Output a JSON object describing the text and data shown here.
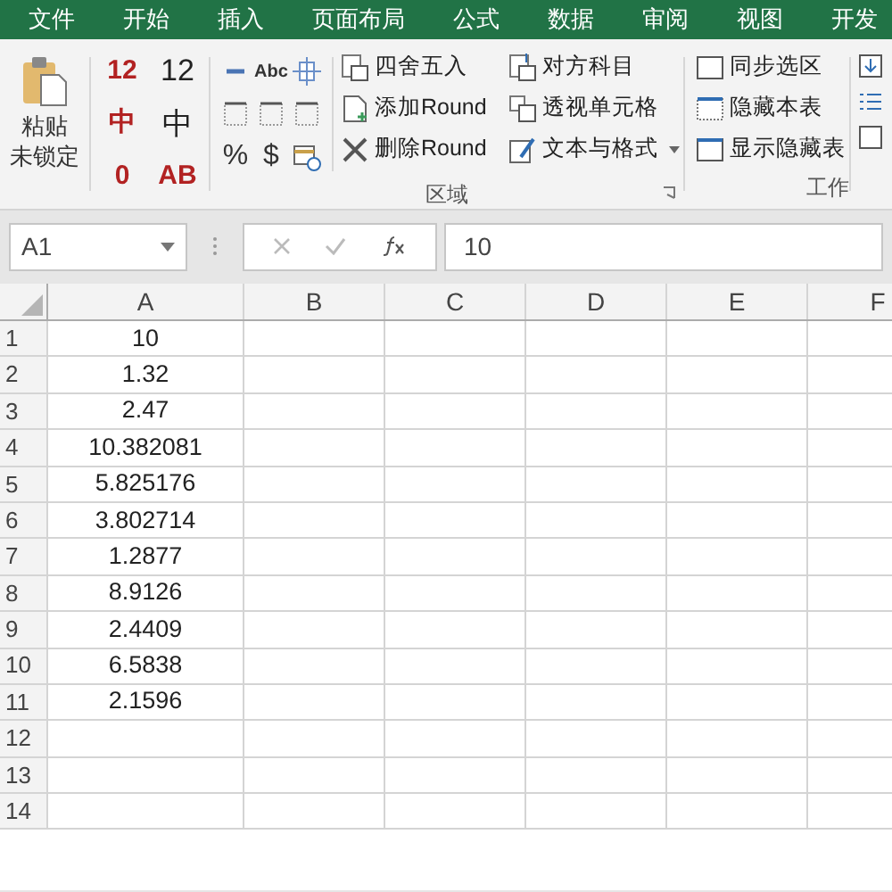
{
  "menu_tabs": [
    "文件",
    "开始",
    "插入",
    "页面布局",
    "公式",
    "数据",
    "审阅",
    "视图",
    "开发"
  ],
  "ribbon": {
    "paste": {
      "line1": "粘贴",
      "line2": "未锁定"
    },
    "small_grid": [
      {
        "label": "12",
        "kind": "struck"
      },
      {
        "label": "12",
        "kind": "plain"
      },
      {
        "label": "中",
        "kind": "struck"
      },
      {
        "label": "中",
        "kind": "plain"
      },
      {
        "label": "0",
        "kind": "struck"
      },
      {
        "label": "AB",
        "kind": "struck"
      }
    ],
    "icon_grid": [
      {
        "kind": "minus"
      },
      {
        "label": "Abc",
        "kind": "text"
      },
      {
        "kind": "grid"
      },
      {
        "kind": "border"
      },
      {
        "kind": "border"
      },
      {
        "kind": "border"
      },
      {
        "label": "%",
        "kind": "text"
      },
      {
        "label": "$",
        "kind": "text"
      },
      {
        "kind": "calendar"
      }
    ],
    "buttons_col1": [
      "四舍五入",
      "添加Round",
      "删除Round"
    ],
    "buttons_col2": [
      "对方科目",
      "透视单元格",
      "文本与格式"
    ],
    "group_label": "区域",
    "sheet_buttons": [
      "同步选区",
      "隐藏本表",
      "显示隐藏表"
    ],
    "group2_label": "工作"
  },
  "formula_bar": {
    "name_box": "A1",
    "value": "10"
  },
  "columns": [
    "A",
    "B",
    "C",
    "D",
    "E",
    "F"
  ],
  "rows": [
    {
      "num": "1",
      "a": "10"
    },
    {
      "num": "2",
      "a": "1.32"
    },
    {
      "num": "3",
      "a": "2.47"
    },
    {
      "num": "4",
      "a": "10.382081"
    },
    {
      "num": "5",
      "a": "5.825176"
    },
    {
      "num": "6",
      "a": "3.802714"
    },
    {
      "num": "7",
      "a": "1.2877"
    },
    {
      "num": "8",
      "a": "8.9126"
    },
    {
      "num": "9",
      "a": "2.4409"
    },
    {
      "num": "10",
      "a": "6.5838"
    },
    {
      "num": "11",
      "a": "2.1596"
    },
    {
      "num": "12"
    },
    {
      "num": "13"
    },
    {
      "num": "14"
    }
  ]
}
